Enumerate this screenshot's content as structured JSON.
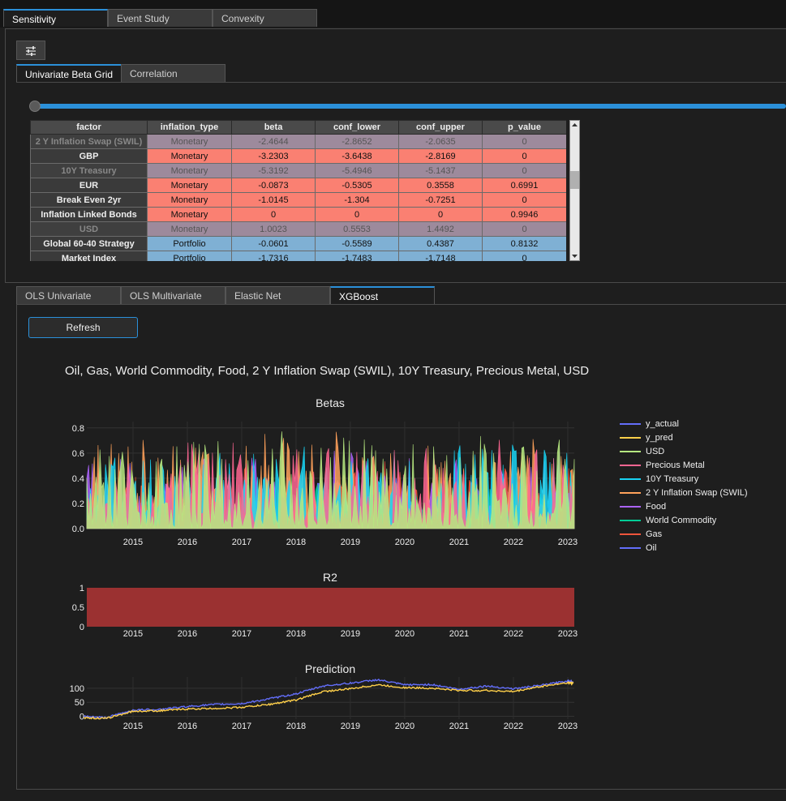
{
  "main_tabs": [
    {
      "label": "Sensitivity"
    },
    {
      "label": "Event Study"
    },
    {
      "label": "Convexity"
    }
  ],
  "grid_tabs": [
    {
      "label": "Univariate Beta Grid"
    },
    {
      "label": "Correlation"
    }
  ],
  "grid": {
    "columns": [
      "factor",
      "inflation_type",
      "beta",
      "conf_lower",
      "conf_upper",
      "p_value"
    ],
    "rows": [
      {
        "factor": "2 Y Inflation Swap (SWIL)",
        "inflation_type": "Monetary",
        "beta": "-2.4644",
        "conf_lower": "-2.8652",
        "conf_upper": "-2.0635",
        "p_value": "0"
      },
      {
        "factor": "GBP",
        "inflation_type": "Monetary",
        "beta": "-3.2303",
        "conf_lower": "-3.6438",
        "conf_upper": "-2.8169",
        "p_value": "0"
      },
      {
        "factor": "10Y Treasury",
        "inflation_type": "Monetary",
        "beta": "-5.3192",
        "conf_lower": "-5.4946",
        "conf_upper": "-5.1437",
        "p_value": "0"
      },
      {
        "factor": "EUR",
        "inflation_type": "Monetary",
        "beta": "-0.0873",
        "conf_lower": "-0.5305",
        "conf_upper": "0.3558",
        "p_value": "0.6991"
      },
      {
        "factor": "Break Even 2yr",
        "inflation_type": "Monetary",
        "beta": "-1.0145",
        "conf_lower": "-1.304",
        "conf_upper": "-0.7251",
        "p_value": "0"
      },
      {
        "factor": "Inflation Linked Bonds",
        "inflation_type": "Monetary",
        "beta": "0",
        "conf_lower": "0",
        "conf_upper": "0",
        "p_value": "0.9946"
      },
      {
        "factor": "USD",
        "inflation_type": "Monetary",
        "beta": "1.0023",
        "conf_lower": "0.5553",
        "conf_upper": "1.4492",
        "p_value": "0"
      },
      {
        "factor": "Global 60-40 Strategy",
        "inflation_type": "Portfolio",
        "beta": "-0.0601",
        "conf_lower": "-0.5589",
        "conf_upper": "0.4387",
        "p_value": "0.8132"
      },
      {
        "factor": "Market Index",
        "inflation_type": "Portfolio",
        "beta": "-1.7316",
        "conf_lower": "-1.7483",
        "conf_upper": "-1.7148",
        "p_value": "0"
      }
    ]
  },
  "model_tabs": [
    {
      "label": "OLS Univariate"
    },
    {
      "label": "OLS Multivariate"
    },
    {
      "label": "Elastic Net"
    },
    {
      "label": "XGBoost"
    }
  ],
  "refresh_label": "Refresh",
  "plot_title": "Oil, Gas, World Commodity, Food, 2 Y Inflation Swap (SWIL), 10Y Treasury, Precious Metal, USD",
  "legend": [
    {
      "name": "y_actual",
      "color": "#636efa"
    },
    {
      "name": "y_pred",
      "color": "#ffd04a"
    },
    {
      "name": "USD",
      "color": "#b6e880"
    },
    {
      "name": "Precious Metal",
      "color": "#ff6692"
    },
    {
      "name": "10Y Treasury",
      "color": "#19d3f3"
    },
    {
      "name": "2 Y Inflation Swap (SWIL)",
      "color": "#ffa15a"
    },
    {
      "name": "Food",
      "color": "#ab63fa"
    },
    {
      "name": "World Commodity",
      "color": "#00cc96"
    },
    {
      "name": "Gas",
      "color": "#ef553b"
    },
    {
      "name": "Oil",
      "color": "#636efa"
    }
  ],
  "chart_data": [
    {
      "type": "area",
      "title": "Betas",
      "x_ticks": [
        "2015",
        "2016",
        "2017",
        "2018",
        "2019",
        "2020",
        "2021",
        "2022",
        "2023"
      ],
      "y_ticks": [
        "0.0",
        "0.2",
        "0.4",
        "0.6",
        "0.8"
      ],
      "ylim": [
        0,
        0.85
      ],
      "series": [
        {
          "name": "Oil",
          "peak": 0.45
        },
        {
          "name": "Gas",
          "peak": 0.55
        },
        {
          "name": "World Commodity",
          "peak": 0.4
        },
        {
          "name": "Food",
          "peak": 0.63
        },
        {
          "name": "2 Y Inflation Swap (SWIL)",
          "peak": 0.82
        },
        {
          "name": "10Y Treasury",
          "peak": 0.7
        },
        {
          "name": "Precious Metal",
          "peak": 0.72
        },
        {
          "name": "USD",
          "peak": 0.78
        }
      ]
    },
    {
      "type": "area",
      "title": "R2",
      "x_ticks": [
        "2015",
        "2016",
        "2017",
        "2018",
        "2019",
        "2020",
        "2021",
        "2022",
        "2023"
      ],
      "y_ticks": [
        "0",
        "0.5",
        "1"
      ],
      "ylim": [
        0,
        1
      ],
      "values": [
        1
      ],
      "color": "#9b3131"
    },
    {
      "type": "line",
      "title": "Prediction",
      "x_ticks": [
        "2015",
        "2016",
        "2017",
        "2018",
        "2019",
        "2020",
        "2021",
        "2022",
        "2023"
      ],
      "y_ticks": [
        "0",
        "50",
        "100"
      ],
      "ylim": [
        -10,
        140
      ],
      "series": [
        {
          "name": "y_actual",
          "x": [
            2014.1,
            2014.5,
            2015,
            2015.5,
            2016,
            2016.5,
            2017,
            2017.5,
            2018,
            2018.5,
            2019,
            2019.5,
            2020,
            2020.5,
            2021,
            2021.5,
            2022,
            2022.5,
            2023,
            2023.1
          ],
          "values": [
            0,
            -5,
            22,
            25,
            35,
            42,
            45,
            62,
            80,
            108,
            118,
            130,
            112,
            113,
            96,
            108,
            98,
            110,
            126,
            122
          ]
        },
        {
          "name": "y_pred",
          "x": [
            2014.1,
            2014.5,
            2015,
            2015.5,
            2016,
            2016.5,
            2017,
            2017.5,
            2018,
            2018.5,
            2019,
            2019.5,
            2020,
            2020.5,
            2021,
            2021.5,
            2022,
            2022.5,
            2023,
            2023.1
          ],
          "values": [
            -5,
            -8,
            18,
            20,
            26,
            28,
            32,
            42,
            58,
            88,
            98,
            112,
            102,
            100,
            92,
            92,
            88,
            106,
            120,
            118
          ]
        }
      ]
    }
  ]
}
